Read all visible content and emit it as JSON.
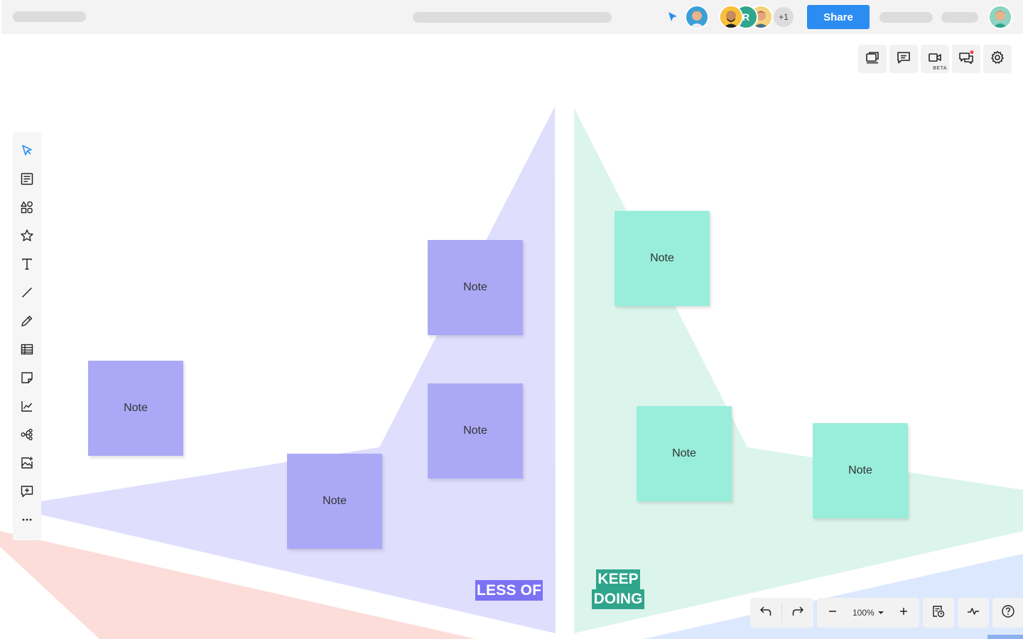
{
  "header": {
    "share_label": "Share",
    "collaborators_overflow": "+1",
    "collaborator_letter": "R"
  },
  "right_tools": [
    {
      "icon": "frames-icon"
    },
    {
      "icon": "comment-icon"
    },
    {
      "icon": "video-icon",
      "badge": "BETA"
    },
    {
      "icon": "chat-icon"
    },
    {
      "icon": "gear-icon"
    }
  ],
  "left_tools": [
    "select-arrow-icon",
    "templates-icon",
    "shapes-icon",
    "star-icon",
    "text-icon",
    "line-icon",
    "pen-icon",
    "table-icon",
    "sticky-note-icon",
    "chart-icon",
    "mindmap-icon",
    "image-icon",
    "add-comment-icon",
    "more-icon"
  ],
  "board": {
    "notes": [
      {
        "text": "Note",
        "color": "purple"
      },
      {
        "text": "Note",
        "color": "purple"
      },
      {
        "text": "Note",
        "color": "purple"
      },
      {
        "text": "Note",
        "color": "purple"
      },
      {
        "text": "Note",
        "color": "teal"
      },
      {
        "text": "Note",
        "color": "teal"
      },
      {
        "text": "Note",
        "color": "teal"
      }
    ],
    "label_less": "LESS OF",
    "label_keep_line1": "KEEP",
    "label_keep_line2": "DOING"
  },
  "bottom_bar": {
    "zoom": "100%"
  },
  "colors": {
    "accent": "#2b8cf2",
    "purple_note": "#aba9f6",
    "teal_note": "#98eddb",
    "purple_area": "#dfdefd",
    "teal_area": "#dbf5ec",
    "red_area": "#fcddd9",
    "blue_area": "#dce8fd"
  }
}
